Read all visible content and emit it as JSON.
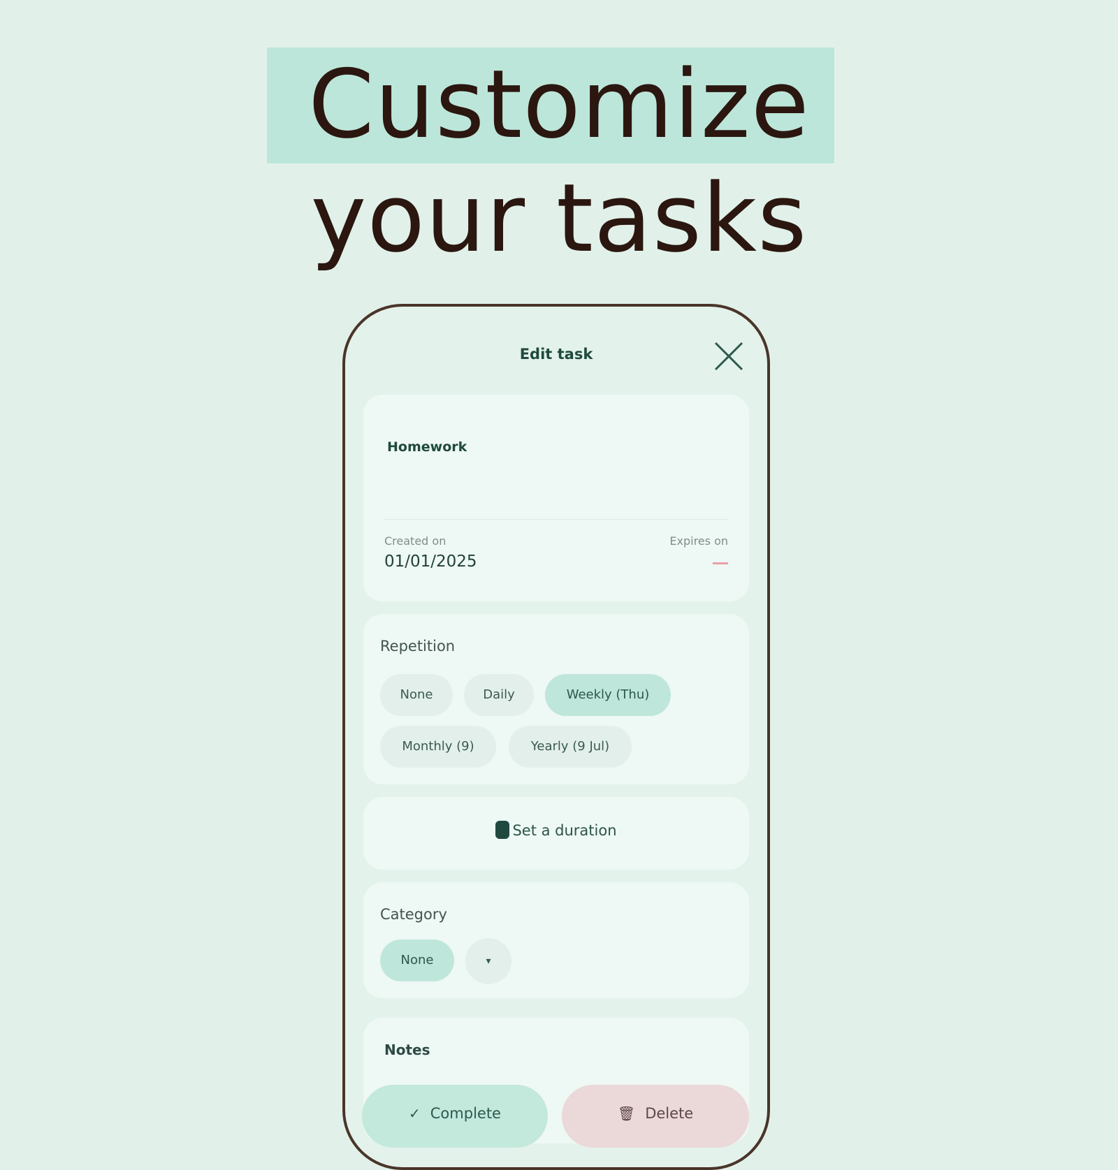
{
  "headline": {
    "line1": "Customize",
    "line2": "your tasks"
  },
  "app_bar": {
    "title": "Edit task",
    "close_icon": "close-icon"
  },
  "task": {
    "name": "Homework",
    "created_label": "Created on",
    "created_value": "01/01/2025",
    "expires_label": "Expires on"
  },
  "repetition": {
    "label": "Repetition",
    "options": [
      "None",
      "Daily",
      "Weekly (Thu)",
      "Monthly (9)",
      "Yearly (9 Jul)"
    ],
    "selected": "Weekly (Thu)"
  },
  "duration": {
    "label": "Set a duration",
    "icon": "timer-icon"
  },
  "category": {
    "label": "Category",
    "value": "None",
    "dropdown_icon": "▾"
  },
  "notes": {
    "label": "Notes"
  },
  "actions": {
    "complete_label": "Complete",
    "complete_icon": "✓",
    "delete_label": "Delete",
    "delete_icon": "🗑"
  },
  "colors": {
    "background": "#e1f1ea",
    "highlight": "#bde6da",
    "headline_text": "#2b1710",
    "phone_border": "#4a3529",
    "chip_selected": "#bfe6da",
    "delete_bg": "#ebd8d8",
    "expires_dash": "#e9a0a6"
  }
}
